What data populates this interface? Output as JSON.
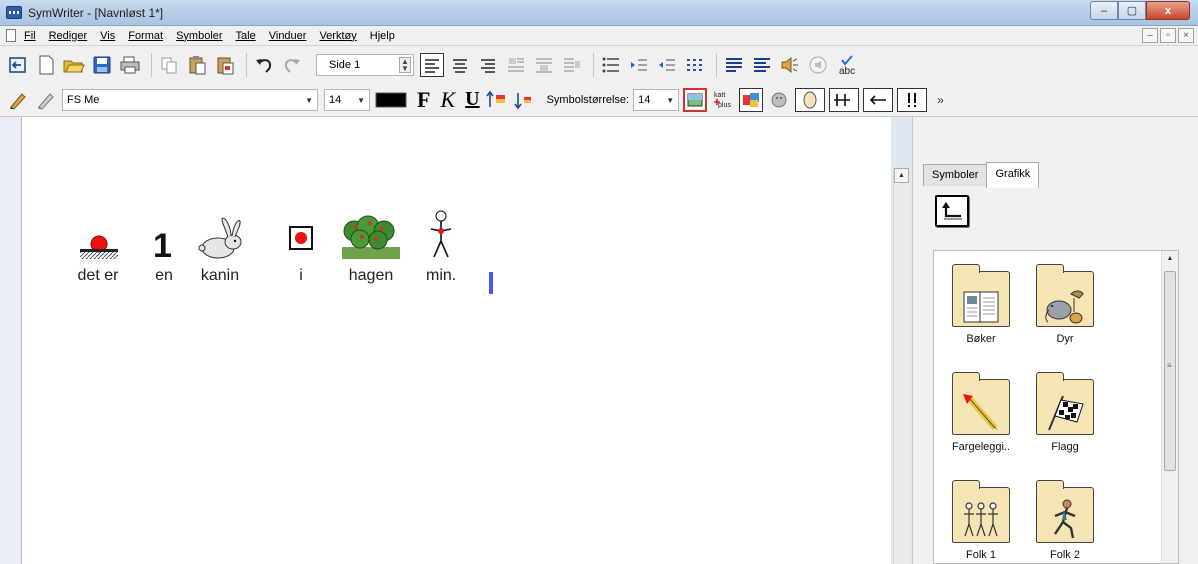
{
  "window": {
    "title": "SymWriter - [Navnløst 1*]",
    "minimize": "–",
    "maximize": "▢",
    "close": "x"
  },
  "menu": {
    "items": [
      "Fil",
      "Rediger",
      "Vis",
      "Format",
      "Symboler",
      "Tale",
      "Vinduer",
      "Verktøy",
      "Hjelp"
    ],
    "mdi_minimize": "–",
    "mdi_restore": "▫",
    "mdi_close": "×"
  },
  "toolbar1": {
    "page_value": "Side 1"
  },
  "toolbar2": {
    "font_name": "FS Me",
    "font_size": "14",
    "bold": "F",
    "italic": "K",
    "underline": "U",
    "symbol_size_label": "Symbolstørrelse:",
    "symbol_size_value": "14",
    "katt_plus": "katt plus",
    "more": "»"
  },
  "document": {
    "words": [
      "det er",
      "en",
      "kanin",
      "i",
      "hagen",
      "min."
    ]
  },
  "panel": {
    "tabs": [
      "Symboler",
      "Grafikk"
    ],
    "active_tab": "Grafikk",
    "folders": [
      {
        "label": "Bøker",
        "icon": "book-icon"
      },
      {
        "label": "Dyr",
        "icon": "animals-icon"
      },
      {
        "label": "Fargeleggi..",
        "icon": "coloring-icon"
      },
      {
        "label": "Flagg",
        "icon": "flag-icon"
      },
      {
        "label": "Folk 1",
        "icon": "people-icon"
      },
      {
        "label": "Folk 2",
        "icon": "runner-icon"
      }
    ]
  },
  "colors": {
    "accent_caret": "#4a57e8",
    "folder": "#f5e5b5",
    "title_bar": "#b9cfe8"
  }
}
